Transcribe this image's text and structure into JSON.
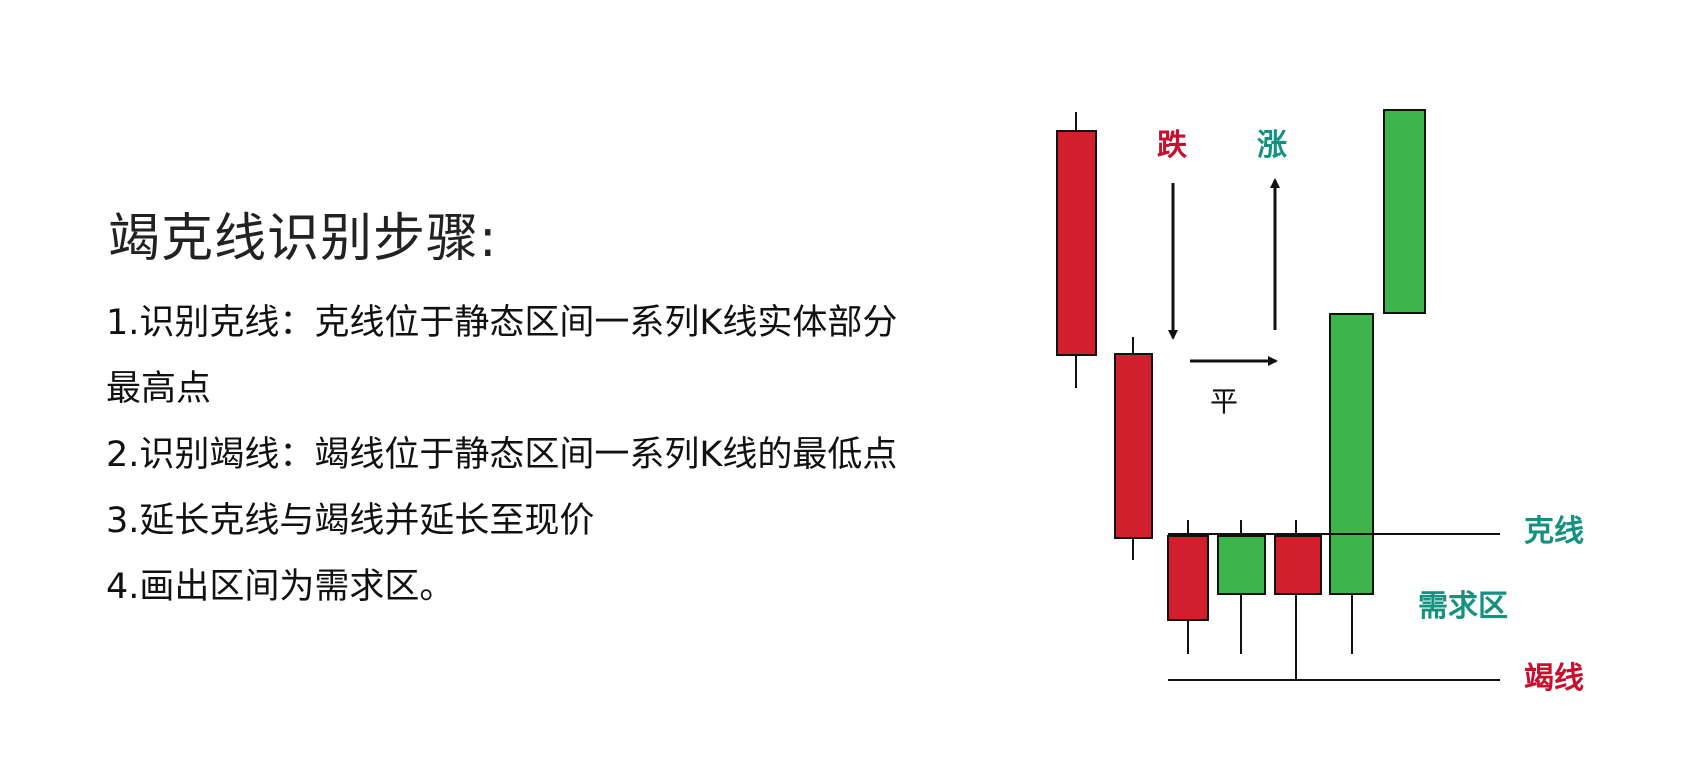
{
  "title": "竭克线识别步骤:",
  "steps": [
    {
      "line1": "1.识别克线：克线位于静态区间一系列K线实体部分",
      "line2": "最高点"
    },
    {
      "line1": "2.识别竭线：竭线位于静态区间一系列K线的最低点"
    },
    {
      "line1": "3.延长克线与竭线并延长至现价"
    },
    {
      "line1": "4.画出区间为需求区。"
    }
  ],
  "diagram": {
    "labels": {
      "fall": "跌",
      "rise": "涨",
      "flat": "平",
      "resistance_line": "克线",
      "demand_zone": "需求区",
      "exhaustion_line": "竭线"
    },
    "colors": {
      "bear": "#d0202e",
      "bull": "#3db54a",
      "red_text": "#c8102e",
      "teal_text": "#14917f",
      "line": "#111111"
    }
  }
}
